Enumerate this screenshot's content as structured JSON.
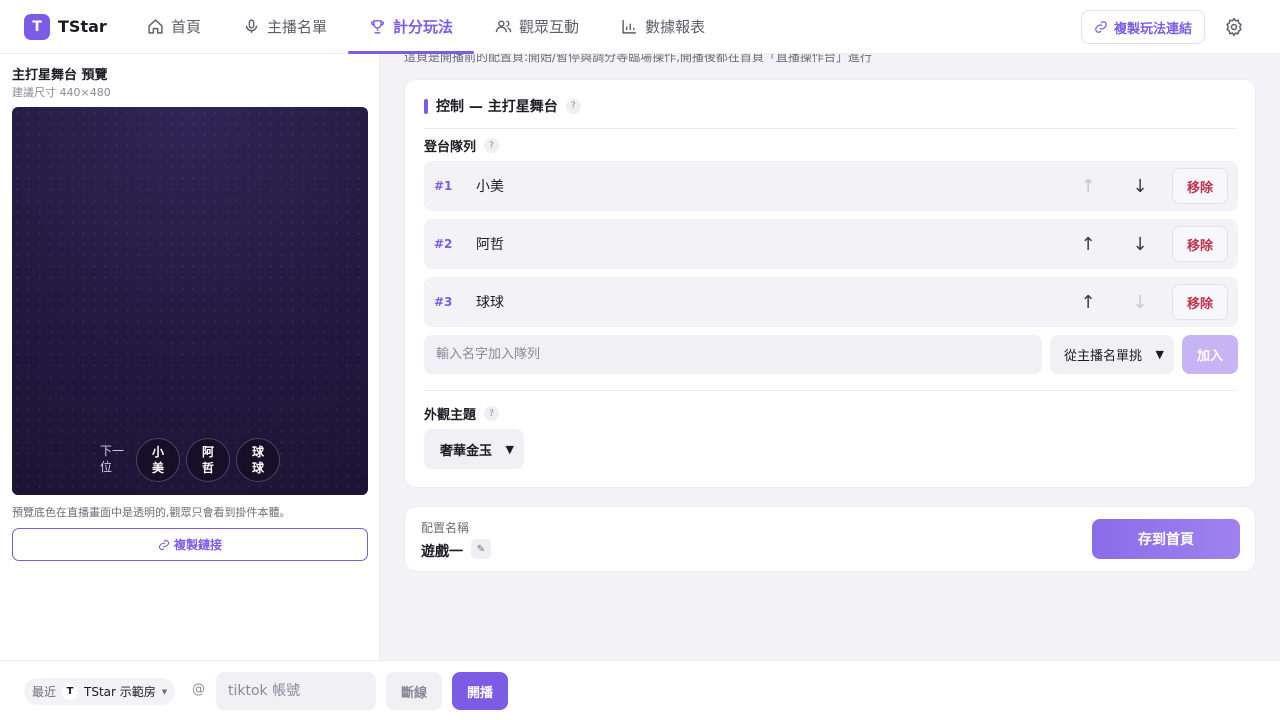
{
  "app": {
    "logo_letter": "T",
    "name": "TStar",
    "accent": "#7c5ce6"
  },
  "nav": {
    "items": [
      {
        "label": "首頁",
        "icon": "home-icon"
      },
      {
        "label": "主播名單",
        "icon": "microphone-icon"
      },
      {
        "label": "計分玩法",
        "icon": "trophy-icon",
        "active": true
      },
      {
        "label": "觀眾互動",
        "icon": "users-icon"
      },
      {
        "label": "數據報表",
        "icon": "bar-chart-icon"
      }
    ],
    "copy_link_label": "複製玩法連結"
  },
  "preview": {
    "title": "主打星舞台 預覽",
    "size_hint": "建議尺寸 440×480",
    "next_label": "下一位",
    "queue_chips": [
      "小美",
      "阿哲",
      "球球"
    ],
    "note": "預覽底色在直播畫面中是透明的,觀眾只會看到掛件本體。",
    "copy_label": "複製鏈接"
  },
  "main": {
    "hint": "這頁是開播前的配置頁:開始/暫停與調分等臨場操作,開播後都在首頁「直播操作台」進行"
  },
  "control": {
    "title": "控制 — 主打星舞台",
    "queue_label": "登台隊列",
    "queue": [
      {
        "num": "#1",
        "name": "小美",
        "up": "↑",
        "down": "↓",
        "remove": "移除",
        "up_enabled": false,
        "down_enabled": true
      },
      {
        "num": "#2",
        "name": "阿哲",
        "up": "↑",
        "down": "↓",
        "remove": "移除",
        "up_enabled": true,
        "down_enabled": true
      },
      {
        "num": "#3",
        "name": "球球",
        "up": "↑",
        "down": "↓",
        "remove": "移除",
        "up_enabled": true,
        "down_enabled": false
      }
    ],
    "add_placeholder": "輸入名字加入隊列",
    "pick_from_list": "從主播名單挑",
    "add_label": "加入",
    "theme_label": "外觀主題",
    "theme_value": "奢華金玉"
  },
  "config": {
    "label": "配置名稱",
    "name": "遊戲一",
    "edit_icon": "pencil-icon",
    "save_label": "存到首頁"
  },
  "bottom": {
    "recent_label": "最近",
    "room_letter": "T",
    "room_name": "TStar 示範房",
    "at": "@",
    "account_placeholder": "tiktok 帳號",
    "disconnect_label": "斷線",
    "go_live_label": "開播"
  }
}
